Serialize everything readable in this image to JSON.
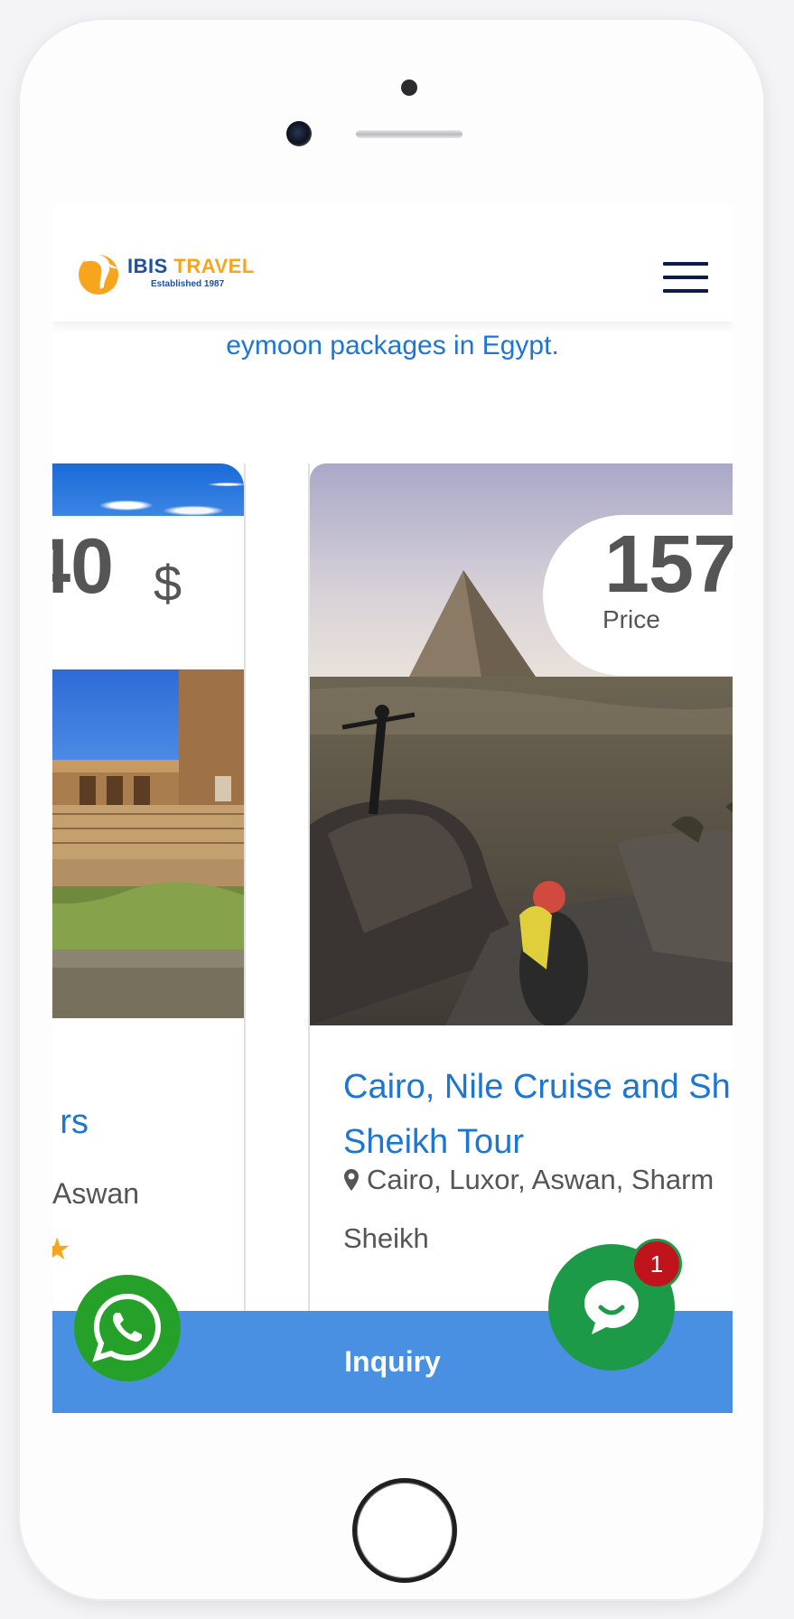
{
  "header": {
    "logo_title_main": "IBIS",
    "logo_title_accent": "TRAVEL",
    "logo_subtitle": "Established 1987",
    "menu_icon": "hamburger-menu-icon"
  },
  "intro_text": "eymoon packages in Egypt.",
  "cards": [
    {
      "price": "40",
      "currency": "$",
      "title": "rs",
      "location": "Aswan"
    },
    {
      "price": "157",
      "price_label": "Price",
      "title_line1": "Cairo, Nile Cruise and Sh",
      "title_line2": "Sheikh Tour",
      "location_line1": "Cairo, Luxor, Aswan, Sharm",
      "location_line2": "Sheikh"
    }
  ],
  "inquiry_label": "Inquiry",
  "chat_badge_count": "1",
  "colors": {
    "accent_blue": "#1c76d2",
    "inquiry_bar": "#4a90e2",
    "whatsapp_green": "#25a12a",
    "chat_green": "#1d9a48",
    "badge_red": "#c0141c",
    "brand_orange": "#f7a51c",
    "menu_navy": "#0d1b4b"
  }
}
